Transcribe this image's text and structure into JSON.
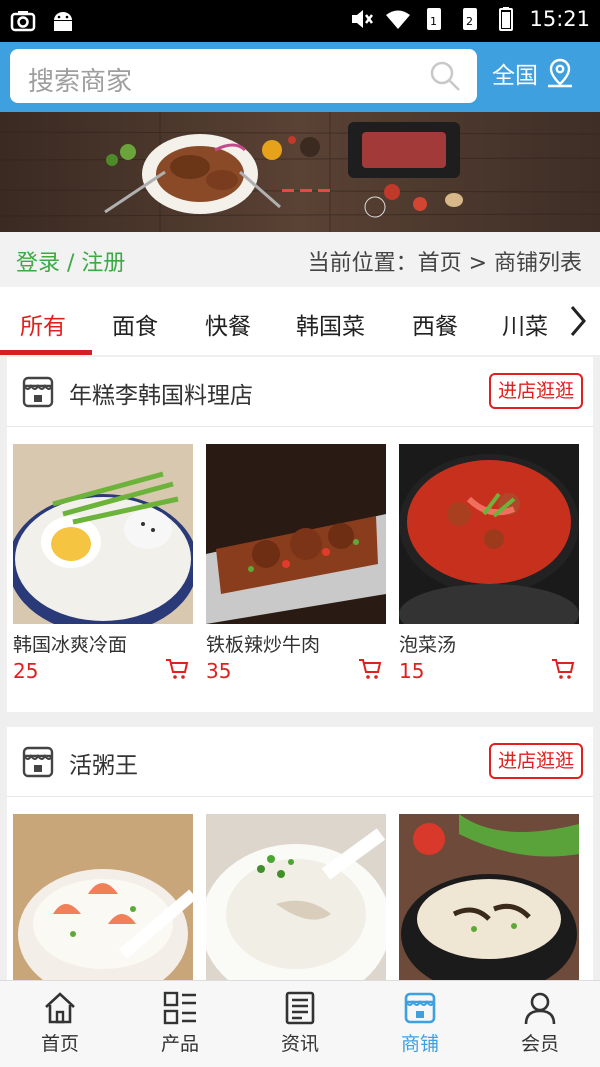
{
  "status_bar": {
    "time": "15:21"
  },
  "search": {
    "placeholder": "搜索商家"
  },
  "region": {
    "label": "全国"
  },
  "nav": {
    "login_label": "登录 / 注册",
    "location_prefix": "当前位置：",
    "breadcrumb": "首页 > 商铺列表"
  },
  "categories": [
    {
      "label": "所有",
      "active": true
    },
    {
      "label": "面食"
    },
    {
      "label": "快餐"
    },
    {
      "label": "韩国菜"
    },
    {
      "label": "西餐"
    },
    {
      "label": "川菜"
    }
  ],
  "shops": [
    {
      "name": "年糕李韩国料理店",
      "enter_label": "进店逛逛",
      "products": [
        {
          "name": "韩国冰爽冷面",
          "price": "25"
        },
        {
          "name": "铁板辣炒牛肉",
          "price": "35"
        },
        {
          "name": "泡菜汤",
          "price": "15"
        }
      ]
    },
    {
      "name": "活粥王",
      "enter_label": "进店逛逛",
      "products": [
        {
          "name": "",
          "price": ""
        },
        {
          "name": "",
          "price": ""
        },
        {
          "name": "",
          "price": ""
        }
      ]
    }
  ],
  "bottom_nav": [
    {
      "label": "首页",
      "icon": "home-icon"
    },
    {
      "label": "产品",
      "icon": "grid-list-icon"
    },
    {
      "label": "资讯",
      "icon": "news-icon"
    },
    {
      "label": "商铺",
      "icon": "store-icon",
      "active": true
    },
    {
      "label": "会员",
      "icon": "user-icon"
    }
  ],
  "colors": {
    "primary": "#3fa0e0",
    "accent": "#e02020",
    "login": "#3ea845"
  }
}
